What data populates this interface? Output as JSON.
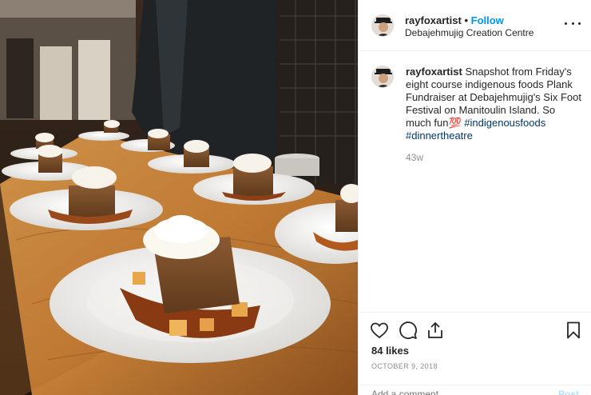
{
  "post": {
    "username": "rayfoxartist",
    "separator": "•",
    "follow_label": "Follow",
    "location": "Debajehmujig Creation Centre",
    "caption_user": "rayfoxartist",
    "caption_text": "Snapshot from Friday's eight course indigenous foods Plank Fundraiser at Debajehmujig's Six Foot Festival on Manitoulin Island. So much fun💯",
    "hashtags": [
      "#indigenousfoods",
      "#dinnertheatre"
    ],
    "age": "43w",
    "likes": "84 likes",
    "date": "OCTOBER 9, 2018",
    "comment_placeholder": "Add a comment…",
    "post_label": "Post"
  },
  "icons": {
    "more": "more-options-icon",
    "like": "heart-icon",
    "comment": "comment-icon",
    "share": "share-icon",
    "save": "bookmark-icon"
  },
  "colors": {
    "link_blue": "#0095f6",
    "hashtag": "#00376b",
    "muted": "#8e8e8e"
  }
}
